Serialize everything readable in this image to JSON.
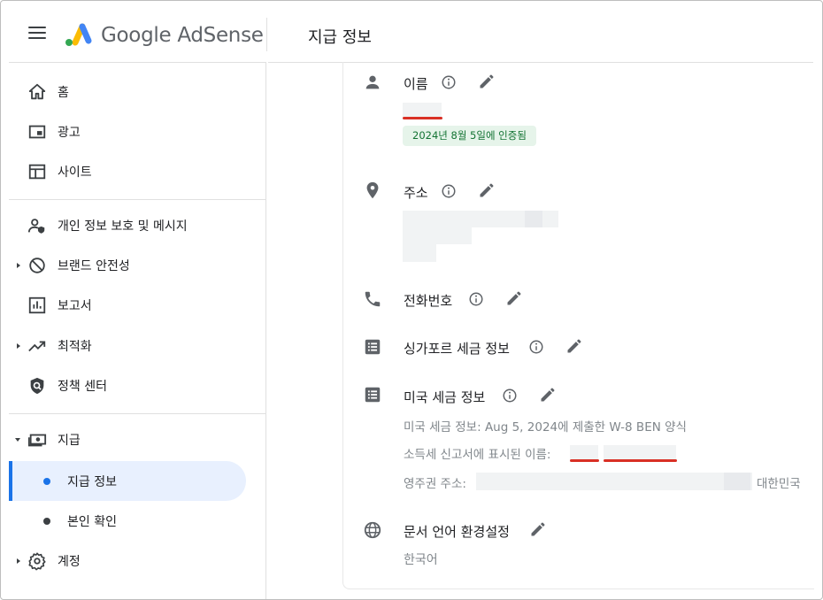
{
  "app": {
    "brand": "Google AdSense",
    "page_title": "지급 정보"
  },
  "sidebar": {
    "items": [
      {
        "label": "홈",
        "icon": "home-icon"
      },
      {
        "label": "광고",
        "icon": "ads-icon"
      },
      {
        "label": "사이트",
        "icon": "sites-icon"
      },
      {
        "label": "개인 정보 보호 및 메시지",
        "icon": "privacy-icon"
      },
      {
        "label": "브랜드 안전성",
        "icon": "block-icon"
      },
      {
        "label": "보고서",
        "icon": "reports-icon"
      },
      {
        "label": "최적화",
        "icon": "trending-icon"
      },
      {
        "label": "정책 센터",
        "icon": "policy-icon"
      },
      {
        "label": "지급",
        "icon": "payments-icon"
      },
      {
        "label": "계정",
        "icon": "gear-icon"
      }
    ],
    "sub_items": [
      {
        "label": "지급 정보",
        "active": true
      },
      {
        "label": "본인 확인",
        "active": false
      }
    ]
  },
  "main": {
    "name": {
      "title": "이름",
      "verified_badge": "2024년 8월 5일에 인증됨"
    },
    "address": {
      "title": "주소"
    },
    "phone": {
      "title": "전화번호"
    },
    "singapore_tax": {
      "title": "싱가포르 세금 정보"
    },
    "us_tax": {
      "title": "미국 세금 정보",
      "line1": "미국 세금 정보: Aug 5, 2024에 제출한 W-8 BEN 양식",
      "line2_label": "소득세 신고서에 표시된 이름:",
      "line3_label": "영주권 주소:",
      "line3_country": "대한민국"
    },
    "language": {
      "title": "문서 언어 환경설정",
      "value": "한국어"
    }
  },
  "colors": {
    "accent": "#1a73e8",
    "active_bg": "#e8f0fe",
    "badge_bg": "#e6f4ea",
    "badge_text": "#137333",
    "redline": "#d93025"
  }
}
